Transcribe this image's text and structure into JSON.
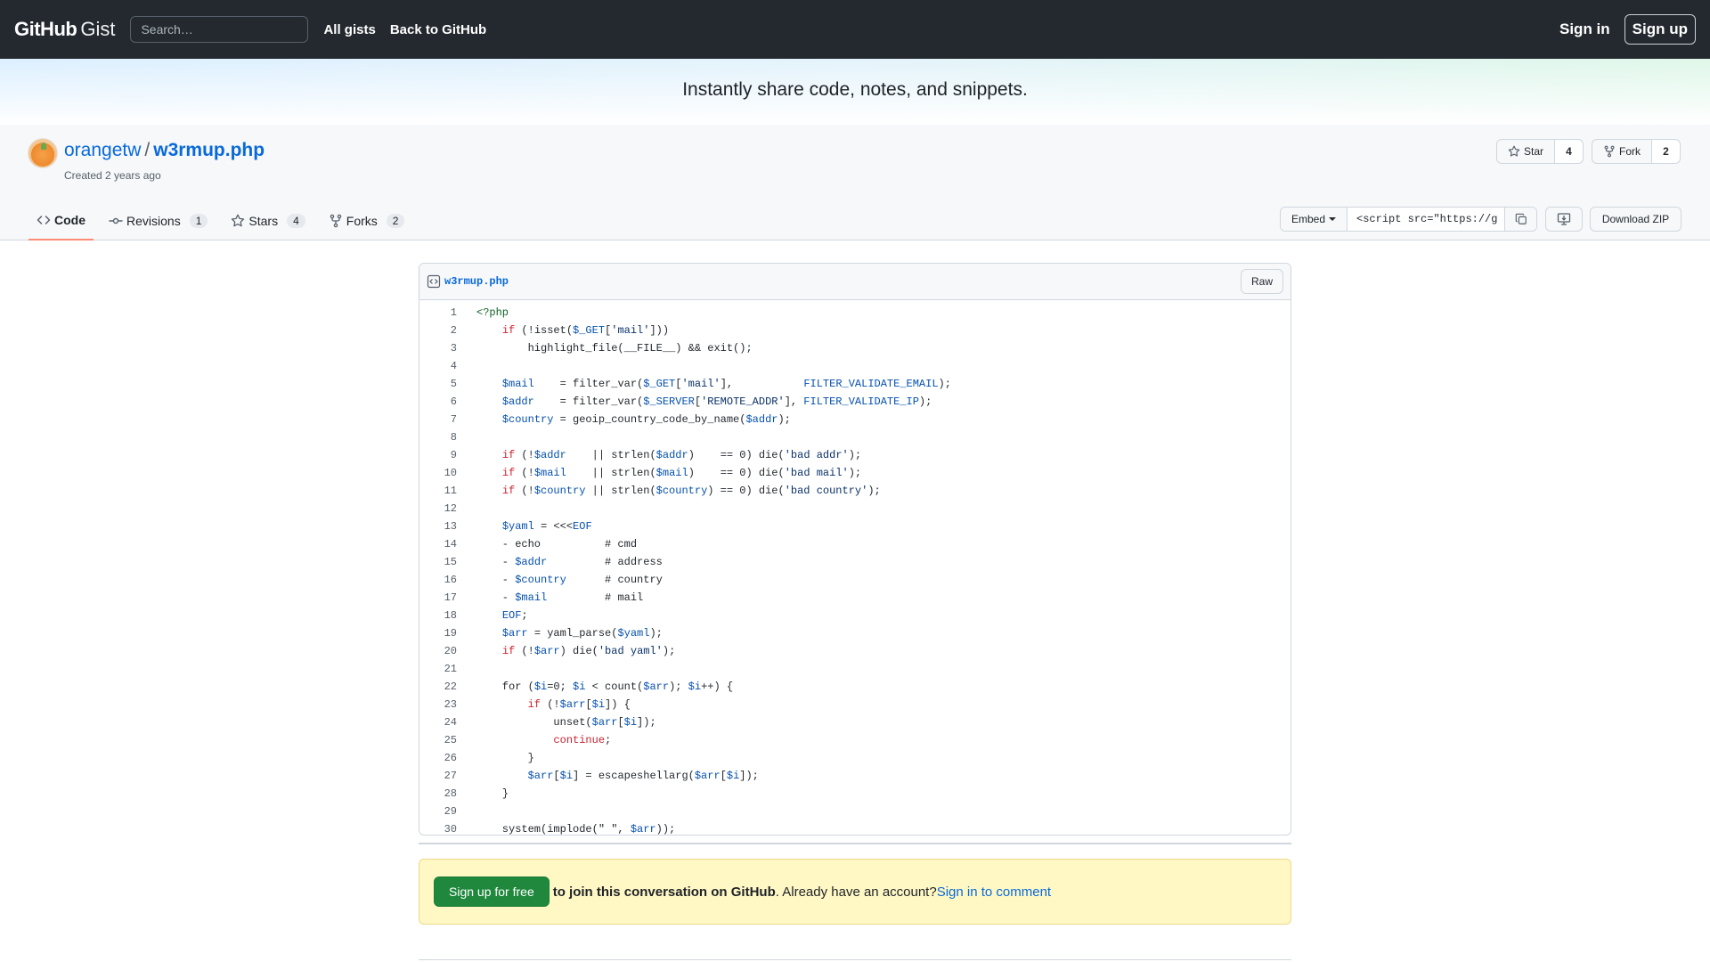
{
  "header": {
    "logo_bold": "GitHub",
    "logo_light": "Gist",
    "search_placeholder": "Search…",
    "nav": [
      "All gists",
      "Back to GitHub"
    ],
    "signin": "Sign in",
    "signup": "Sign up"
  },
  "banner": {
    "text": "Instantly share code, notes, and snippets."
  },
  "gist": {
    "owner": "orangetw",
    "separator": "/",
    "filename": "w3rmup.php",
    "created": "Created 2 years ago",
    "star_label": "Star",
    "star_count": "4",
    "fork_label": "Fork",
    "fork_count": "2"
  },
  "tabs": [
    {
      "label": "Code",
      "count": ""
    },
    {
      "label": "Revisions",
      "count": "1"
    },
    {
      "label": "Stars",
      "count": "4"
    },
    {
      "label": "Forks",
      "count": "2"
    }
  ],
  "embed": {
    "select_label": "Embed",
    "value": "<script src=\"https://g"
  },
  "download_zip": "Download ZIP",
  "file": {
    "name": "w3rmup.php",
    "raw_label": "Raw",
    "lines": [
      "<?php",
      "    if (!isset($_GET['mail']))",
      "        highlight_file(__FILE__) && exit();",
      "",
      "    $mail    = filter_var($_GET['mail'],           FILTER_VALIDATE_EMAIL);",
      "    $addr    = filter_var($_SERVER['REMOTE_ADDR'], FILTER_VALIDATE_IP);",
      "    $country = geoip_country_code_by_name($addr);",
      "",
      "    if (!$addr    || strlen($addr)    == 0) die('bad addr');",
      "    if (!$mail    || strlen($mail)    == 0) die('bad mail');",
      "    if (!$country || strlen($country) == 0) die('bad country');",
      "",
      "    $yaml = <<<EOF",
      "    - echo          # cmd",
      "    - $addr         # address",
      "    - $country      # country",
      "    - $mail         # mail",
      "    EOF;",
      "    $arr = yaml_parse($yaml);",
      "    if (!$arr) die('bad yaml');",
      "",
      "    for ($i=0; $i < count($arr); $i++) {",
      "        if (!$arr[$i]) {",
      "            unset($arr[$i]);",
      "            continue;",
      "        }",
      "        $arr[$i] = escapeshellarg($arr[$i]);",
      "    }",
      "",
      "    system(implode(\" \", $arr));"
    ]
  },
  "cta": {
    "button": "Sign up for free",
    "bold": "to join this conversation on GitHub",
    "middle": ". Already have an account? ",
    "link": "Sign in to comment"
  },
  "colors": {
    "header_bg": "#24292f",
    "link": "#0969da",
    "keyword": "#cf222e",
    "primary_button": "#1f883d"
  }
}
